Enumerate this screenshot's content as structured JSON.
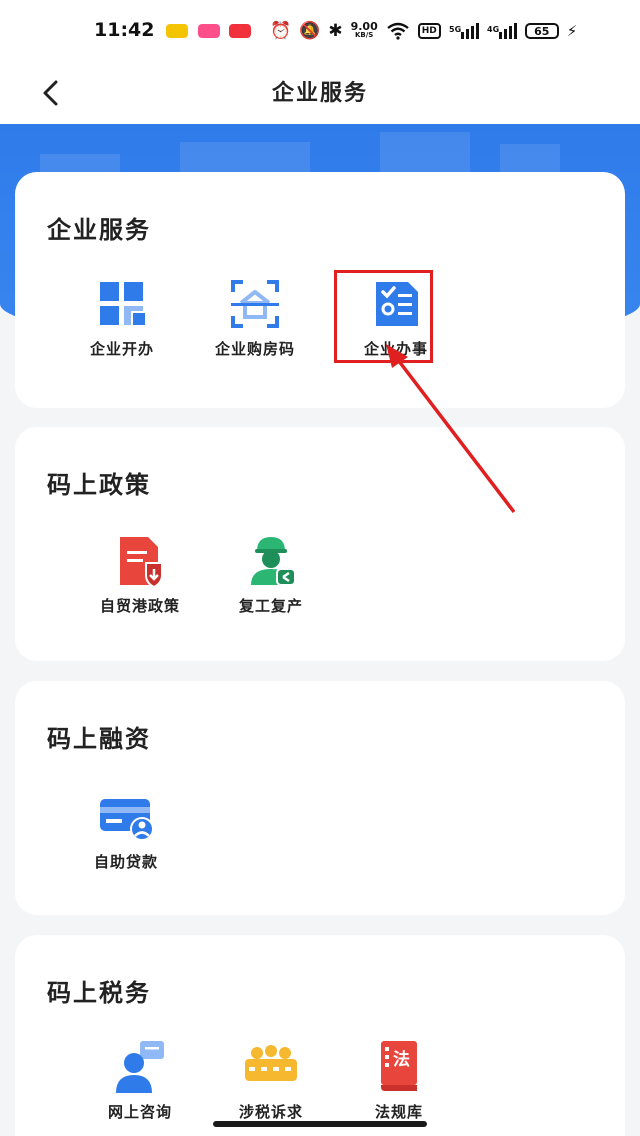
{
  "status_bar": {
    "time": "11:42",
    "network_speed_value": "9.00",
    "network_speed_unit": "KB/S",
    "hd_label": "HD",
    "battery": "65"
  },
  "header": {
    "title": "企业服务",
    "back_icon": "chevron-left-icon"
  },
  "sections": [
    {
      "title": "企业服务",
      "items": [
        {
          "label": "企业开办",
          "icon": "grid-apps-icon"
        },
        {
          "label": "企业购房码",
          "icon": "scan-house-icon"
        },
        {
          "label": "企业办事",
          "icon": "checklist-document-icon"
        }
      ]
    },
    {
      "title": "码上政策",
      "items": [
        {
          "label": "自贸港政策",
          "icon": "policy-document-icon"
        },
        {
          "label": "复工复产",
          "icon": "worker-icon"
        }
      ]
    },
    {
      "title": "码上融资",
      "items": [
        {
          "label": "自助贷款",
          "icon": "bank-card-icon"
        }
      ]
    },
    {
      "title": "码上税务",
      "items": [
        {
          "label": "网上咨询",
          "icon": "consult-person-icon"
        },
        {
          "label": "涉税诉求",
          "icon": "crowd-icon"
        },
        {
          "label": "法规库",
          "icon": "law-book-icon"
        }
      ]
    }
  ],
  "colors": {
    "accent_blue": "#2f7bea",
    "highlight_red": "#e02020",
    "policy_red": "#e8453c",
    "worker_green": "#2bb673",
    "tax_yellow": "#f5b82e"
  }
}
